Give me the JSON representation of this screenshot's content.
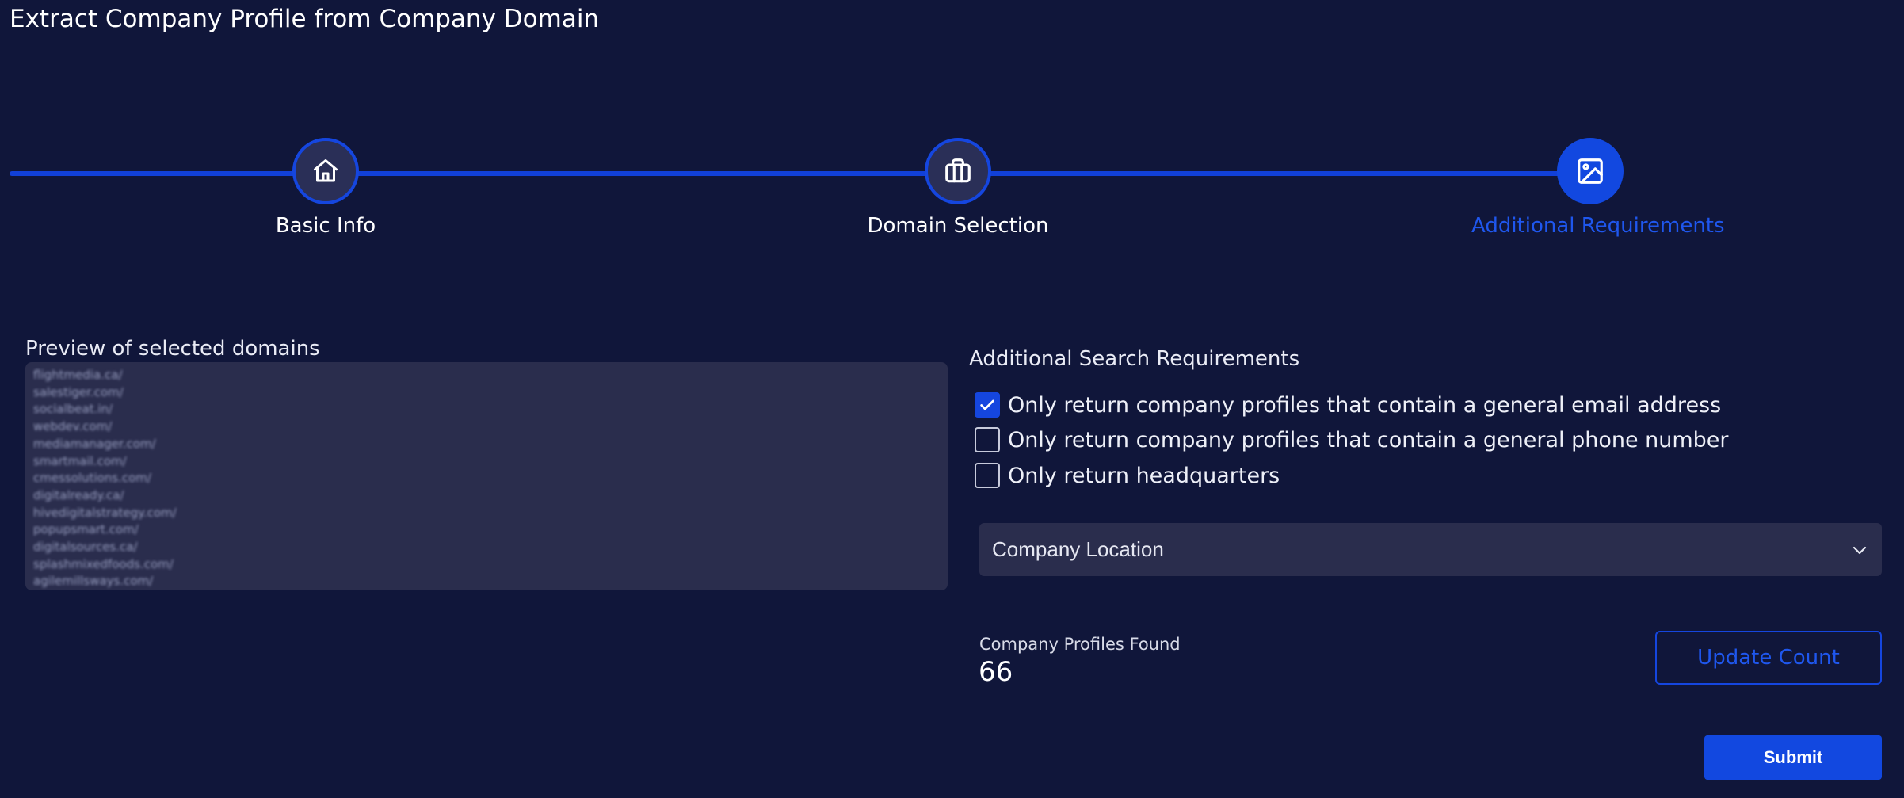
{
  "page": {
    "title": "Extract Company Profile from Company Domain"
  },
  "stepper": {
    "steps": [
      {
        "label": "Basic Info",
        "icon": "home-icon",
        "active": false
      },
      {
        "label": "Domain Selection",
        "icon": "briefcase-icon",
        "active": false
      },
      {
        "label": "Additional Requirements",
        "icon": "image-icon",
        "active": true
      }
    ]
  },
  "preview": {
    "title": "Preview of selected domains",
    "domains": [
      "flightmedia.ca/",
      "salestiger.com/",
      "socialbeat.in/",
      "webdev.com/",
      "mediamanager.com/",
      "smartmail.com/",
      "cmessolutions.com/",
      "digitalready.ca/",
      "hivedigitalstrategy.com/",
      "popupsmart.com/",
      "digitalsources.ca/",
      "splashmixedfoods.com/",
      "agilemillsways.com/"
    ]
  },
  "requirements": {
    "title": "Additional Search Requirements",
    "options": [
      {
        "label": "Only return company profiles that contain a general email address",
        "checked": true
      },
      {
        "label": "Only return company profiles that contain a general phone number",
        "checked": false
      },
      {
        "label": "Only return headquarters",
        "checked": false
      }
    ],
    "location_select": {
      "value": "Company Location"
    }
  },
  "results": {
    "label": "Company Profiles Found",
    "count": "66",
    "update_label": "Update Count"
  },
  "actions": {
    "submit_label": "Submit"
  },
  "colors": {
    "background": "#10163a",
    "accent": "#1248e0",
    "panel": "#2a2d4d"
  }
}
